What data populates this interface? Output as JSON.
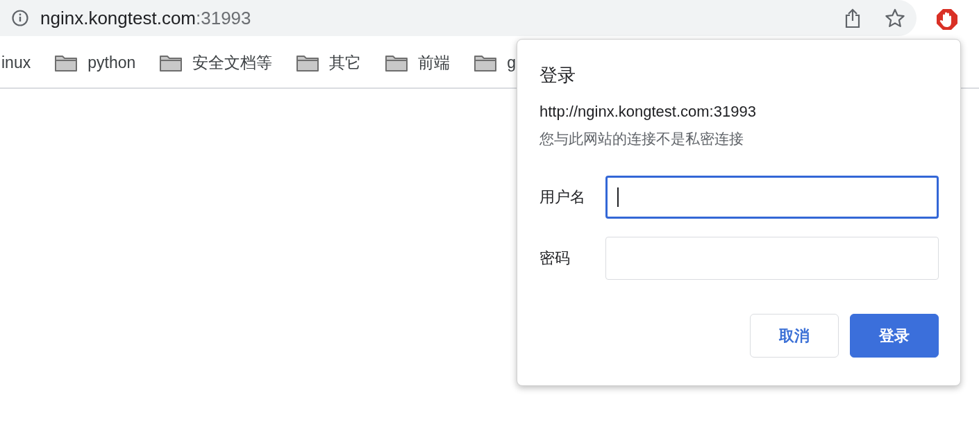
{
  "address_bar": {
    "host": "nginx.kongtest.com",
    "port": ":31993"
  },
  "bookmarks": [
    {
      "label": "inux",
      "kind": "plain"
    },
    {
      "label": "python",
      "kind": "folder"
    },
    {
      "label": "安全文档等",
      "kind": "folder"
    },
    {
      "label": "其它",
      "kind": "folder"
    },
    {
      "label": "前端",
      "kind": "folder"
    },
    {
      "label": "g",
      "kind": "folder"
    }
  ],
  "dialog": {
    "title": "登录",
    "origin": "http://nginx.kongtest.com:31993",
    "warning": "您与此网站的连接不是私密连接",
    "fields": [
      {
        "label": "用户名",
        "focused": true
      },
      {
        "label": "密码",
        "focused": false
      }
    ],
    "buttons": [
      {
        "label": "取消",
        "kind": "secondary"
      },
      {
        "label": "登录",
        "kind": "primary"
      }
    ]
  }
}
